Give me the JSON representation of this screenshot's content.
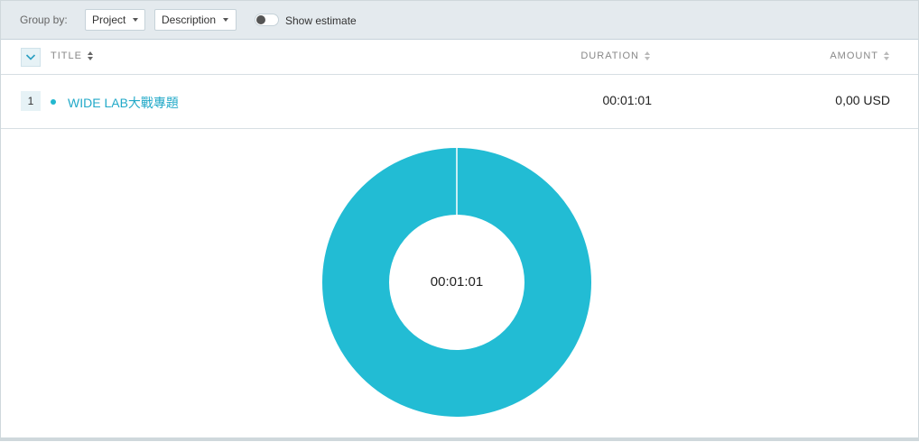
{
  "toolbar": {
    "group_by_label": "Group by:",
    "group_primary": "Project",
    "group_secondary": "Description",
    "show_estimate_label": "Show estimate",
    "show_estimate_on": false
  },
  "table": {
    "columns": {
      "title": "TITLE",
      "duration": "DURATION",
      "amount": "AMOUNT"
    },
    "rows": [
      {
        "index": "1",
        "title": "WIDE LAB大戰專題",
        "duration": "00:01:01",
        "amount": "0,00 USD",
        "color": "#22bcd4"
      }
    ]
  },
  "chart_data": {
    "type": "pie",
    "center_label": "00:01:01",
    "slices": [
      {
        "label": "WIDE LAB大戰專題",
        "value": 61,
        "color": "#22bcd4"
      }
    ]
  },
  "colors": {
    "accent": "#22bcd4",
    "link": "#22a9c8",
    "toolbar_bg": "#e4eaee"
  }
}
